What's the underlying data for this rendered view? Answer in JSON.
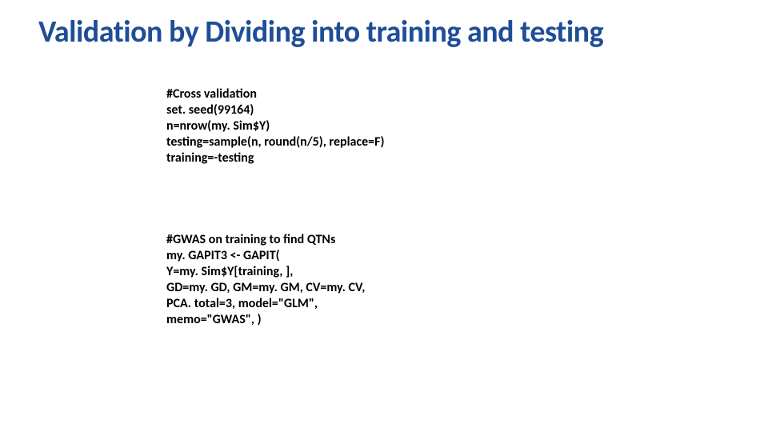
{
  "title": "Validation by Dividing into training and testing",
  "code_block_1": "#Cross validation\nset. seed(99164)\nn=nrow(my. Sim$Y)\ntesting=sample(n, round(n/5), replace=F)\ntraining=-testing",
  "code_block_2": "#GWAS on training to find QTNs\nmy. GAPIT3 <- GAPIT(\nY=my. Sim$Y[training, ],\nGD=my. GD, GM=my. GM, CV=my. CV,\nPCA. total=3, model=\"GLM\",\nmemo=\"GWAS\", )"
}
